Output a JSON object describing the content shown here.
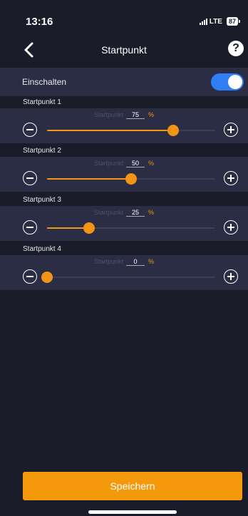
{
  "status": {
    "time": "13:16",
    "network": "LTE",
    "battery": "87"
  },
  "nav": {
    "title": "Startpunkt",
    "help": "?"
  },
  "enable": {
    "label": "Einschalten",
    "on": true
  },
  "sliders": [
    {
      "label": "Startpunkt 1",
      "caption": "Startpunkt",
      "value": "75",
      "unit": "%",
      "fraction": 0.75
    },
    {
      "label": "Startpunkt 2",
      "caption": "Startpunkt",
      "value": "50",
      "unit": "%",
      "fraction": 0.5
    },
    {
      "label": "Startpunkt 3",
      "caption": "Startpunkt",
      "value": "25",
      "unit": "%",
      "fraction": 0.25
    },
    {
      "label": "Startpunkt 4",
      "caption": "Startpunkt",
      "value": "0",
      "unit": "%",
      "fraction": 0.0
    }
  ],
  "footer": {
    "save_label": "Speichern"
  },
  "colors": {
    "accent": "#f29414",
    "toggle": "#2f7ef6",
    "panel": "#2a2d43",
    "background": "#1b1c29"
  }
}
